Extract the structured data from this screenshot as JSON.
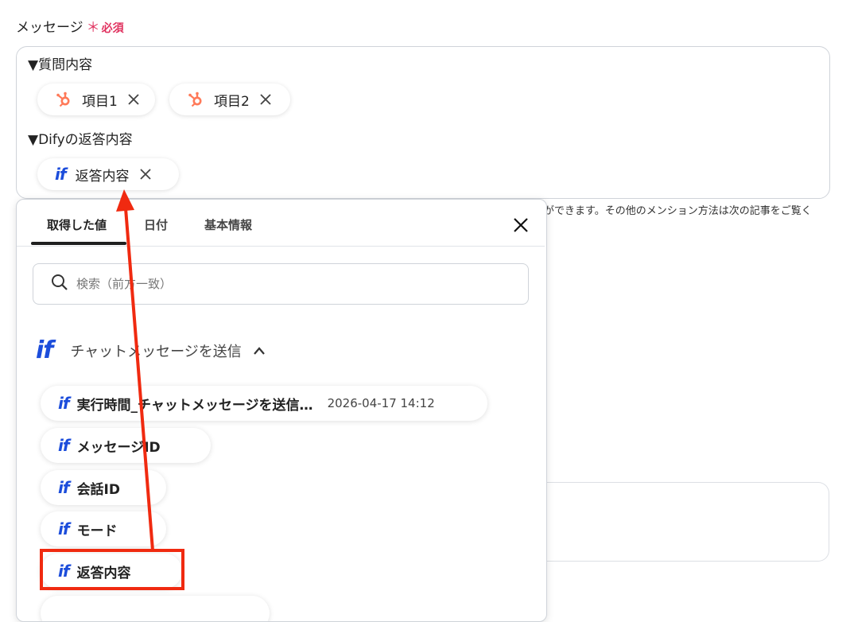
{
  "field": {
    "label": "メッセージ",
    "required_star": "＊",
    "required_text": "必須"
  },
  "message": {
    "line1": "▼質問内容",
    "line2": "▼Difyの返答内容",
    "chips": [
      {
        "label": "項目1",
        "icon": "hubspot-icon"
      },
      {
        "label": "項目2",
        "icon": "hubspot-icon"
      },
      {
        "label": "返答内容",
        "icon": "dify-icon"
      }
    ]
  },
  "hint": "ができます。その他のメンション方法は次の記事をご覧く",
  "panel": {
    "tabs": [
      "取得した値",
      "日付",
      "基本情報"
    ],
    "active_tab": "取得した値",
    "search_placeholder": "検索（前方一致）",
    "section_title": "チャットメッセージを送信",
    "logo_text": "if",
    "options": [
      {
        "label": "実行時間_チャットメッセージを送信…",
        "sub": "2026-04-17 14:12"
      },
      {
        "label": "メッセージID"
      },
      {
        "label": "会話ID"
      },
      {
        "label": "モード"
      },
      {
        "label": "返答内容"
      }
    ]
  },
  "colors": {
    "accent_red": "#f02a10",
    "required": "#e0325f",
    "dify_blue": "#1c4ddb",
    "hubspot_orange": "#ff7a59"
  }
}
